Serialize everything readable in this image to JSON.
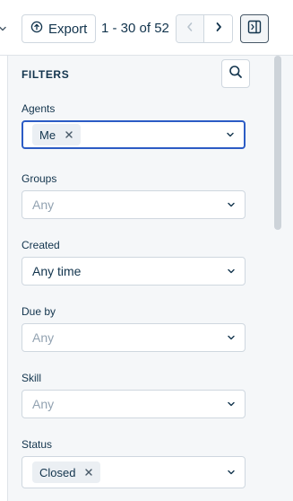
{
  "toolbar": {
    "export_label": "Export",
    "pagination_text": "1 - 30 of 52"
  },
  "filters": {
    "title": "FILTERS",
    "agents": {
      "label": "Agents",
      "chips": [
        "Me"
      ]
    },
    "groups": {
      "label": "Groups",
      "placeholder": "Any"
    },
    "created": {
      "label": "Created",
      "value": "Any time"
    },
    "due_by": {
      "label": "Due by",
      "placeholder": "Any"
    },
    "skill": {
      "label": "Skill",
      "placeholder": "Any"
    },
    "status": {
      "label": "Status",
      "chips": [
        "Closed"
      ]
    }
  },
  "colors": {
    "focus_border": "#2c5cc5",
    "panel_bg": "#f5f7f9",
    "text": "#12344d",
    "placeholder": "#92a2b1"
  },
  "icons": [
    "chevron-down-icon",
    "export-icon",
    "chevron-left-icon",
    "chevron-right-icon",
    "panel-toggle-icon",
    "search-icon",
    "remove-chip-icon"
  ]
}
